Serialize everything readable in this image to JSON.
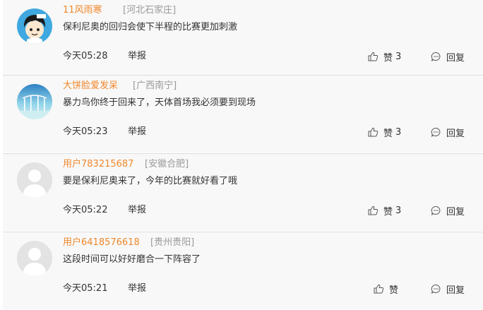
{
  "comments": [
    {
      "username": "11风雨寒",
      "location": "[河北石家庄]",
      "text": "保利尼奥的回归会使下半程的比赛更加刺激",
      "time": "今天05:28",
      "report": "举报",
      "like_label": "赞",
      "like_count": "3",
      "reply_label": "回复",
      "avatar_icon": "cartoon-boy-avatar"
    },
    {
      "username": "大饼脸爱发呆",
      "location": "[广西南宁]",
      "text": "暴力鸟你终于回来了，天体首场我必须要到现场",
      "time": "今天05:23",
      "report": "举报",
      "like_label": "赞",
      "like_count": "3",
      "reply_label": "回复",
      "avatar_icon": "landscape-photo-avatar"
    },
    {
      "username": "用户783215687",
      "location": "[安徽合肥]",
      "text": "要是保利尼奥来了，今年的比赛就好看了哦",
      "time": "今天05:22",
      "report": "举报",
      "like_label": "赞",
      "like_count": "3",
      "reply_label": "回复",
      "avatar_icon": "default-user-avatar"
    },
    {
      "username": "用户6418576618",
      "location": "[贵州贵阳]",
      "text": "这段时间可以好好磨合一下阵容了",
      "time": "今天05:21",
      "report": "举报",
      "like_label": "赞",
      "like_count": "",
      "reply_label": "回复",
      "avatar_icon": "default-user-avatar"
    }
  ],
  "colors": {
    "username": "#f0872b",
    "location": "#999999",
    "text": "#333333",
    "background": "#f8f8f8",
    "divider": "#dddddd"
  }
}
